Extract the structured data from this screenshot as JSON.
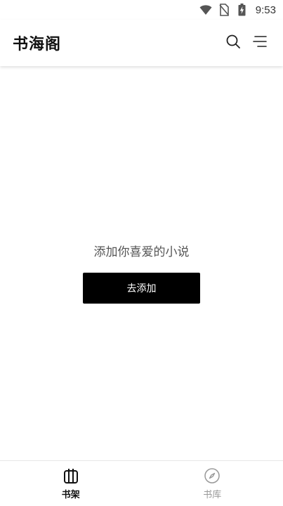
{
  "status_bar": {
    "time": "9:53",
    "icons": [
      "wifi-icon",
      "no-sim-icon",
      "battery-charging-icon"
    ]
  },
  "app_bar": {
    "title": "书海阁",
    "actions": [
      "search-icon",
      "menu-icon"
    ]
  },
  "empty_state": {
    "message": "添加你喜爱的小说",
    "button_label": "去添加"
  },
  "bottom_nav": {
    "items": [
      {
        "label": "书架",
        "icon": "bookshelf-icon",
        "active": true
      },
      {
        "label": "书库",
        "icon": "compass-icon",
        "active": false
      }
    ]
  },
  "colors": {
    "primary": "#000000",
    "background": "#ffffff",
    "inactive": "#999999"
  }
}
